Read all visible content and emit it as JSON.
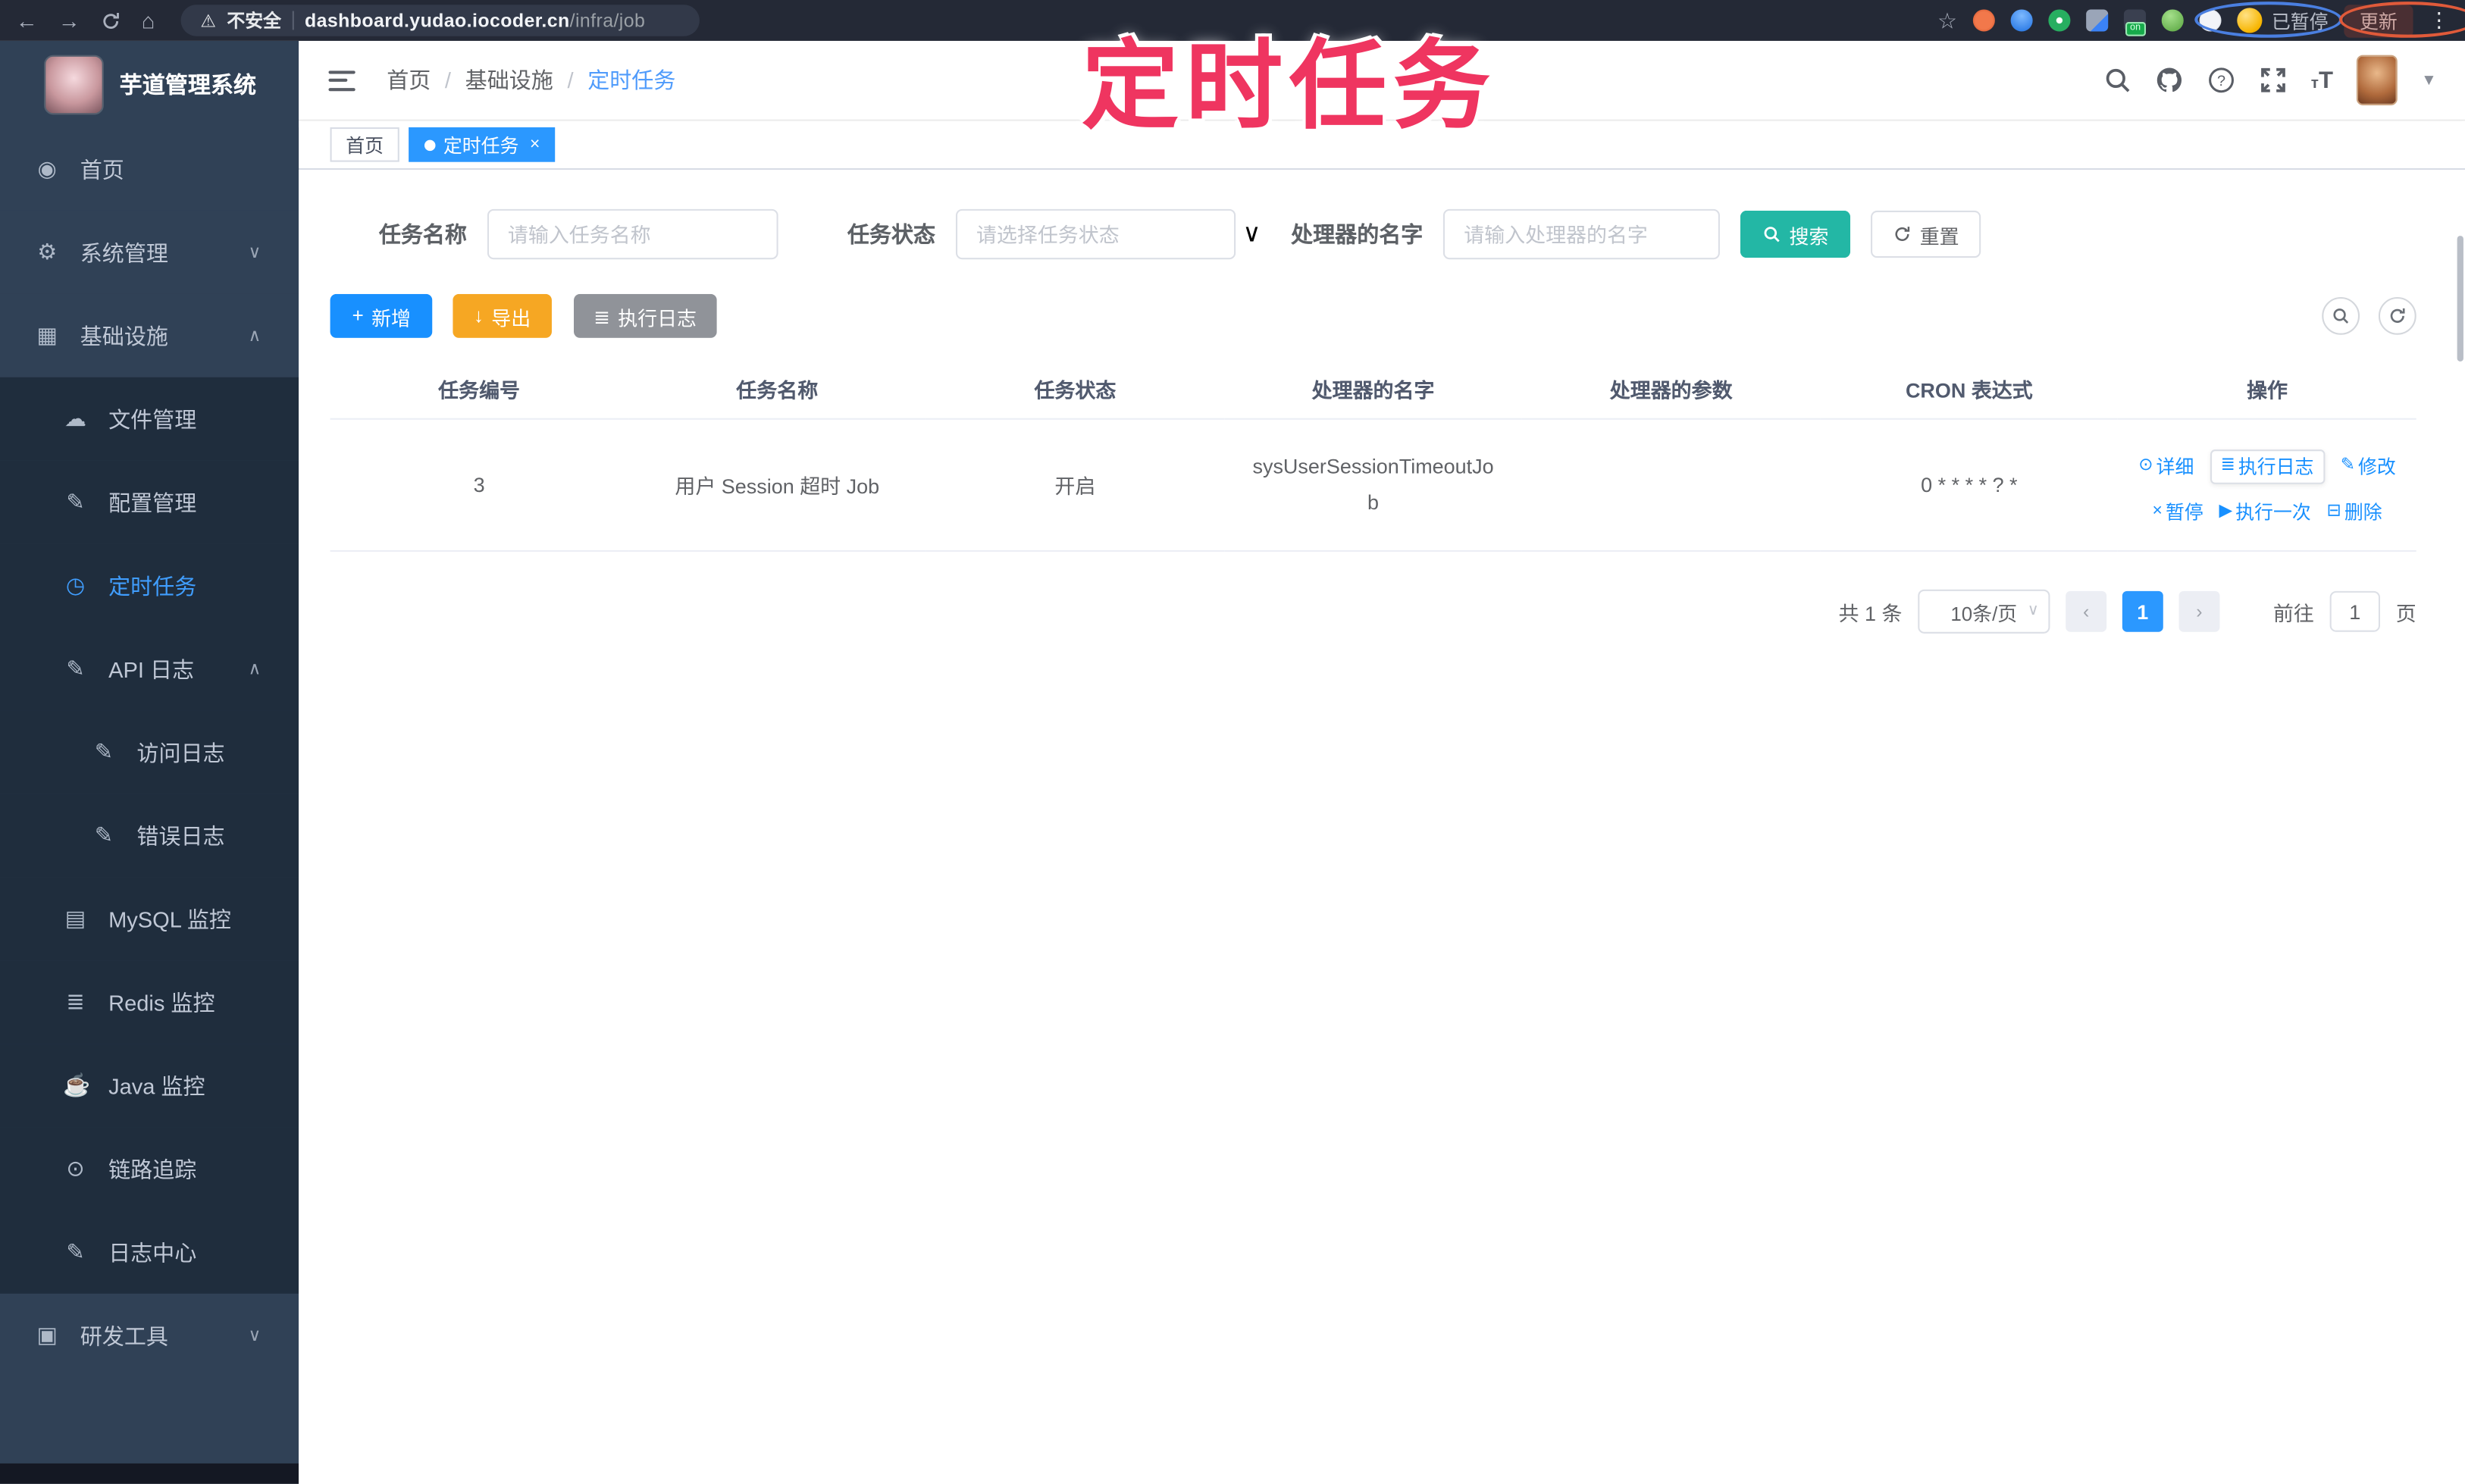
{
  "browser": {
    "security_label": "不安全",
    "url_host": "dashboard.yudao.iocoder.cn",
    "url_path": "/infra/job",
    "paused_label": "已暂停",
    "update_label": "更新",
    "ext_on_badge": "on"
  },
  "annotation": {
    "title": "定时任务"
  },
  "sidebar": {
    "title": "芋道管理系统",
    "items": [
      {
        "label": "首页",
        "glyph": "◉"
      },
      {
        "label": "系统管理",
        "glyph": "⚙",
        "arrow": "∨"
      },
      {
        "label": "基础设施",
        "glyph": "▦",
        "arrow": "∧"
      },
      {
        "label": "文件管理",
        "glyph": "☁"
      },
      {
        "label": "配置管理",
        "glyph": "✎"
      },
      {
        "label": "定时任务",
        "glyph": "◷"
      },
      {
        "label": "API 日志",
        "glyph": "✎",
        "arrow": "∧"
      },
      {
        "label": "访问日志",
        "glyph": "✎"
      },
      {
        "label": "错误日志",
        "glyph": "✎"
      },
      {
        "label": "MySQL 监控",
        "glyph": "▤"
      },
      {
        "label": "Redis 监控",
        "glyph": "≣"
      },
      {
        "label": "Java 监控",
        "glyph": "☕"
      },
      {
        "label": "链路追踪",
        "glyph": "⊙"
      },
      {
        "label": "日志中心",
        "glyph": "✎"
      },
      {
        "label": "研发工具",
        "glyph": "▣",
        "arrow": "∨"
      }
    ]
  },
  "header": {
    "breadcrumb": [
      "首页",
      "基础设施",
      "定时任务"
    ],
    "separator": "/",
    "tabs": [
      {
        "label": "首页"
      },
      {
        "label": "定时任务",
        "close": "×"
      }
    ]
  },
  "filters": {
    "name_label": "任务名称",
    "name_placeholder": "请输入任务名称",
    "status_label": "任务状态",
    "status_placeholder": "请选择任务状态",
    "handler_label": "处理器的名字",
    "handler_placeholder": "请输入处理器的名字",
    "search_label": "搜索",
    "reset_label": "重置"
  },
  "toolbar": {
    "add_label": "新增",
    "add_glyph": "+",
    "export_label": "导出",
    "export_glyph": "↓",
    "exec_log_label": "执行日志",
    "exec_log_glyph": "≣"
  },
  "table": {
    "columns": [
      "任务编号",
      "任务名称",
      "任务状态",
      "处理器的名字",
      "处理器的参数",
      "CRON 表达式",
      "操作"
    ],
    "rows": [
      {
        "id": "3",
        "name": "用户 Session 超时 Job",
        "status": "开启",
        "handler": "sysUserSessionTimeoutJob",
        "params": "",
        "cron": "0 * * * * ? *",
        "actions": {
          "detail": "详细",
          "detail_glyph": "⊙",
          "exec_log": "执行日志",
          "exec_log_glyph": "≣",
          "edit": "修改",
          "edit_glyph": "✎",
          "pause": "暂停",
          "pause_glyph": "×",
          "run_once": "执行一次",
          "run_once_glyph": "▶",
          "delete": "删除",
          "delete_glyph": "⊟"
        }
      }
    ]
  },
  "pagination": {
    "total_text": "共 1 条",
    "page_size": "10条/页",
    "prev": "‹",
    "page": "1",
    "next": "›",
    "goto_label": "前往",
    "goto_value": "1",
    "unit_label": "页"
  },
  "colors": {
    "accent_blue": "#1890ff",
    "active_blue": "#409eff",
    "teal_search": "#23b7a5",
    "warning_orange": "#f6a723",
    "info_gray": "#909399",
    "annotation_pink": "#ef3560",
    "sidebar_bg": "#304156",
    "submenu_bg": "#1f2d3d"
  }
}
